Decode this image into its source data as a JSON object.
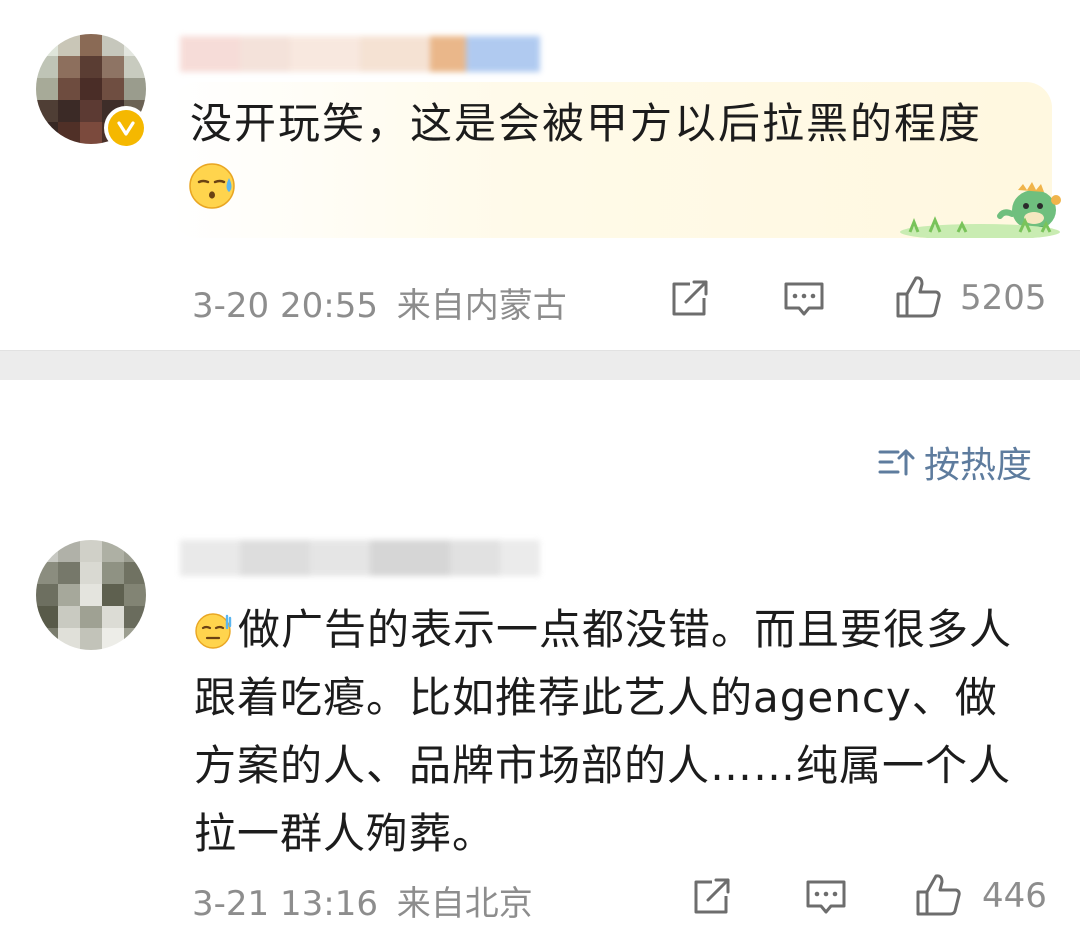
{
  "comments": [
    {
      "text": "没开玩笑，这是会被甲方以后拉黑的程度",
      "emoji": "sweat-face",
      "sticker": "green-dinosaur",
      "verified": true,
      "date": "3-20 20:55",
      "location": "来自内蒙古",
      "likes": "5205"
    },
    {
      "text": "做广告的表示一点都没错。而且要很多人跟着吃瘪。比如推荐此艺人的agency、做方案的人、品牌市场部的人……纯属一个人拉一群人殉葬。",
      "emoji": "sweat-face",
      "date": "3-21 13:16",
      "location": "来自北京",
      "likes": "446"
    }
  ],
  "sort": {
    "label": "按热度"
  },
  "colors": {
    "text": "#1c1c1c",
    "meta": "#8d8d8d",
    "link": "#5e7c9e",
    "separator": "#ececec",
    "verified": "#f5b800"
  },
  "icons": [
    "share-icon",
    "comment-icon",
    "like-icon",
    "sort-icon",
    "verified-icon"
  ]
}
